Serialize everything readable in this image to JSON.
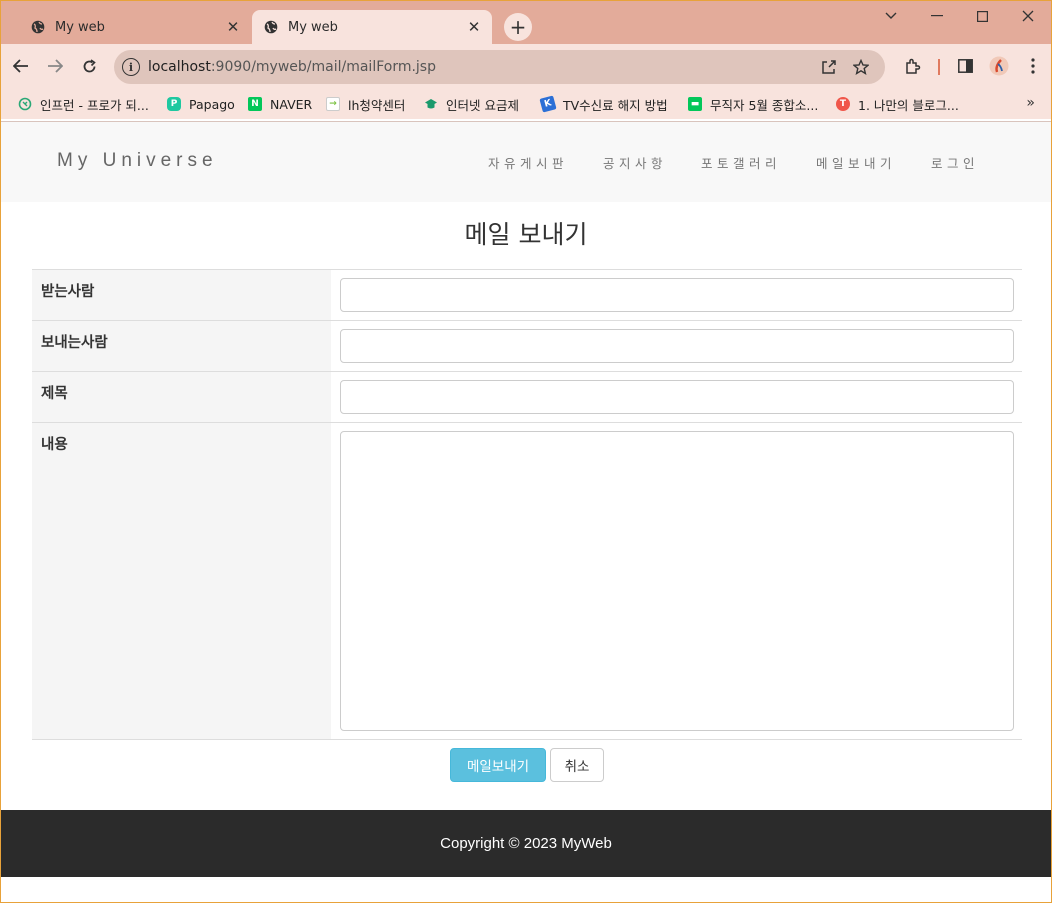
{
  "browser": {
    "tabs": [
      {
        "title": "My web"
      },
      {
        "title": "My web"
      }
    ],
    "url_host": "localhost",
    "url_path": ":9090/myweb/mail/mailForm.jsp",
    "bookmarks": [
      {
        "label": "인프런 - 프로가 되...",
        "color": "#2aa876"
      },
      {
        "label": "Papago",
        "color": "#1ec8a0"
      },
      {
        "label": "NAVER",
        "color": "#03c75a"
      },
      {
        "label": "lh청약센터",
        "color": "#7cc243"
      },
      {
        "label": "인터넷 요금제",
        "color": "#1a9a6c"
      },
      {
        "label": "TV수신료 해지 방법",
        "color": "#2b6fd6"
      },
      {
        "label": "무직자 5월 종합소...",
        "color": "#03c75a"
      },
      {
        "label": "1. 나만의 블로그...",
        "color": "#f0564a"
      }
    ],
    "more_label": "»"
  },
  "site": {
    "brand": "My Universe",
    "nav": [
      "자유게시판",
      "공지사항",
      "포토갤러리",
      "메일보내기",
      "로그인"
    ]
  },
  "form": {
    "title": "메일 보내기",
    "fields": [
      {
        "label": "받는사람",
        "value": ""
      },
      {
        "label": "보내는사람",
        "value": ""
      },
      {
        "label": "제목",
        "value": ""
      },
      {
        "label": "내용",
        "value": ""
      }
    ],
    "submit_label": "메일보내기",
    "cancel_label": "취소"
  },
  "footer": {
    "text": "Copyright © 2023 MyWeb"
  }
}
